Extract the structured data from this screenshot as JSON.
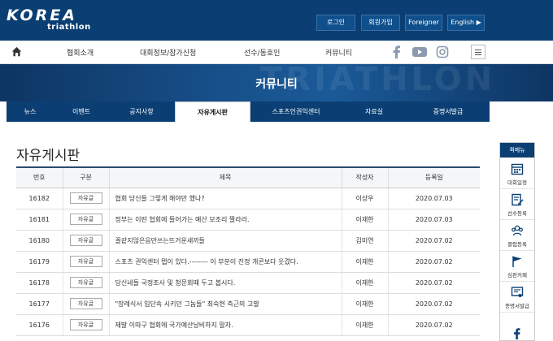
{
  "header": {
    "logo_word": "KOREA",
    "logo_sub": "triathlon",
    "buttons": [
      "로그인",
      "회원가입",
      "Foreigner",
      "English ▶"
    ]
  },
  "nav": {
    "items": [
      "협회소개",
      "대회정보/참가신청",
      "선수/동호인",
      "커뮤니티"
    ],
    "social": [
      "facebook-icon",
      "youtube-icon",
      "instagram-icon"
    ]
  },
  "banner": {
    "title": "커뮤니티",
    "ghost": "TRIATHLON"
  },
  "subtabs": {
    "items": [
      "뉴스",
      "이벤트",
      "공지사항",
      "자유게시판",
      "스포츠인권익센터",
      "자료실",
      "증명서발급"
    ],
    "active": "자유게시판"
  },
  "board": {
    "title": "자유게시판",
    "columns": [
      "번호",
      "구분",
      "제목",
      "작성자",
      "등록일"
    ],
    "rows": [
      {
        "no": "16182",
        "cat": "자유글",
        "title": "협회 당신들 그렇게 해야만 했나?",
        "author": "이상우",
        "date": "2020.07.03"
      },
      {
        "no": "16181",
        "cat": "자유글",
        "title": "정부는 이딴 협회에 들어가는 예산 모조리 짤라라.",
        "author": "이재한",
        "date": "2020.07.03"
      },
      {
        "no": "16180",
        "cat": "자유글",
        "title": "꼴같지않은음만쓰는뜨거운새끼들",
        "author": "김미연",
        "date": "2020.07.02"
      },
      {
        "no": "16179",
        "cat": "자유글",
        "title": "스포츠 권익센터 탭이 있다.-------- 이 부분이 진정 개콘보다 웃겼다.",
        "author": "이재한",
        "date": "2020.07.02"
      },
      {
        "no": "16178",
        "cat": "자유글",
        "title": "당신네들 국정조사 및 청문회때 두고 봅시다.",
        "author": "이재한",
        "date": "2020.07.02"
      },
      {
        "no": "16177",
        "cat": "자유글",
        "title": "\"장례식서 입단속 시키던 그놈들\" 최숙현 측근의 고발",
        "author": "이재한",
        "date": "2020.07.02"
      },
      {
        "no": "16176",
        "cat": "자유글",
        "title": "제발 이따구 협회에 국가예산낭비하지 말자.",
        "author": "이재한",
        "date": "2020.07.02"
      }
    ]
  },
  "quick_menu": {
    "title": "퀵메뉴",
    "items": [
      {
        "label": "대회일정",
        "icon": "calendar-icon"
      },
      {
        "label": "선수등록",
        "icon": "edit-icon"
      },
      {
        "label": "클럽등록",
        "icon": "group-icon"
      },
      {
        "label": "심판카페",
        "icon": "flag-icon"
      },
      {
        "label": "증명서발급",
        "icon": "certificate-icon"
      }
    ]
  }
}
